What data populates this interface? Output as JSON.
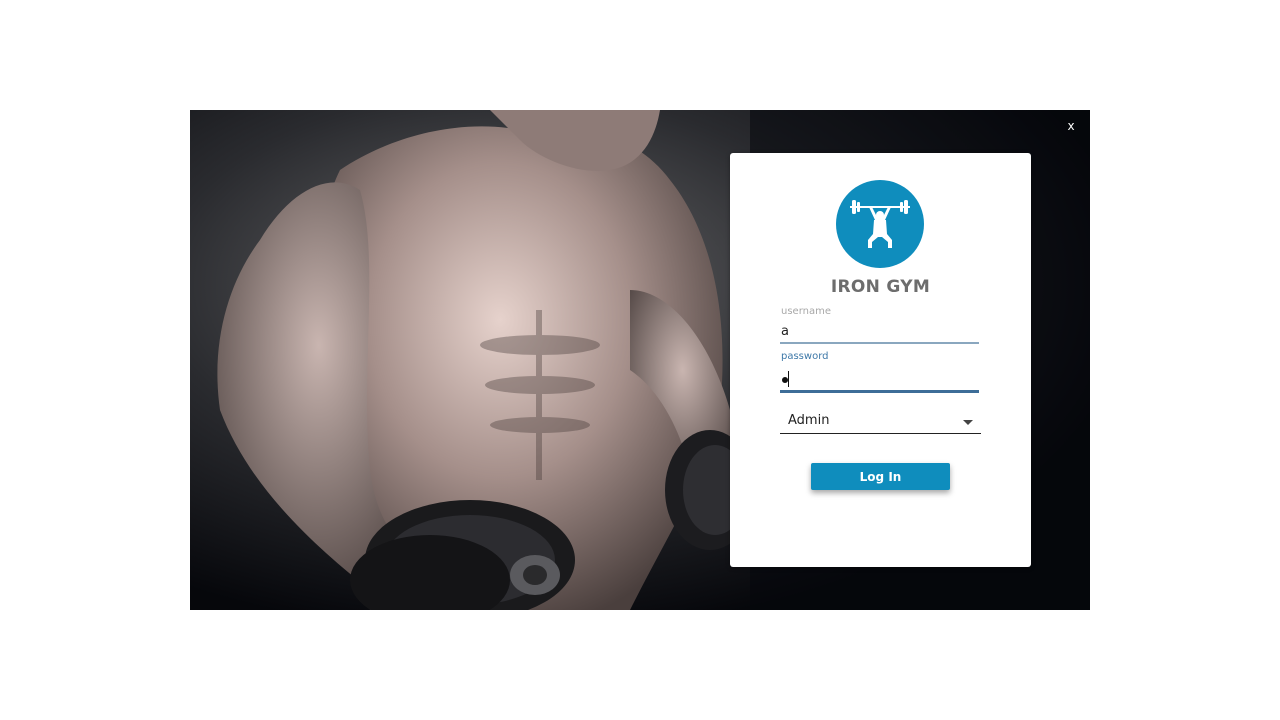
{
  "window": {
    "close_label": "x"
  },
  "login": {
    "logo_icon": "weightlifter-icon",
    "brand": "IRON GYM",
    "username_label": "username",
    "username_value": "a",
    "password_label": "password",
    "role_value": "Admin",
    "login_label": "Log In"
  },
  "colors": {
    "accent": "#0f8dbd",
    "label_active": "#3d78a8",
    "brand_text": "#6d6d6d"
  }
}
